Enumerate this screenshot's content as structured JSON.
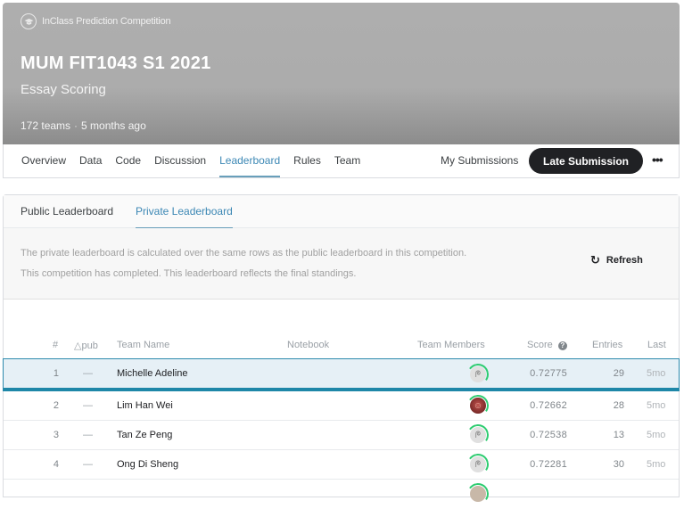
{
  "header": {
    "competition_type": "InClass Prediction Competition",
    "competition_type_icon": "graduation-cap-icon",
    "title": "MUM FIT1043 S1 2021",
    "subtitle": "Essay Scoring",
    "teams": "172 teams",
    "separator": "·",
    "time": "5 months ago"
  },
  "nav": {
    "tabs": [
      {
        "label": "Overview"
      },
      {
        "label": "Data"
      },
      {
        "label": "Code"
      },
      {
        "label": "Discussion"
      },
      {
        "label": "Leaderboard",
        "active": true
      },
      {
        "label": "Rules"
      },
      {
        "label": "Team"
      }
    ],
    "my_submissions": "My Submissions",
    "late_submission": "Late Submission",
    "more": "•••"
  },
  "leaderboard": {
    "tabs": [
      {
        "label": "Public Leaderboard"
      },
      {
        "label": "Private Leaderboard",
        "active": true
      }
    ],
    "info_line_1": "The private leaderboard is calculated over the same rows as the public leaderboard in this competition.",
    "info_line_2": "This competition has completed. This leaderboard reflects the final standings.",
    "refresh_icon": "↻",
    "refresh_label": "Refresh",
    "columns": {
      "rank": "#",
      "delta": "△pub",
      "team_name": "Team Name",
      "notebook": "Notebook",
      "team_members": "Team Members",
      "score": "Score",
      "entries": "Entries",
      "last": "Last"
    },
    "score_help_icon": "?",
    "rows": [
      {
        "rank": "1",
        "delta": "—",
        "team_name": "Michelle Adeline",
        "avatar_glyph": "ᖘ",
        "score": "0.72775",
        "entries": "29",
        "last": "5mo"
      },
      {
        "rank": "2",
        "delta": "—",
        "team_name": "Lim Han Wei",
        "avatar_glyph": "☺",
        "score": "0.72662",
        "entries": "28",
        "last": "5mo"
      },
      {
        "rank": "3",
        "delta": "—",
        "team_name": "Tan Ze Peng",
        "avatar_glyph": "ᖘ",
        "score": "0.72538",
        "entries": "13",
        "last": "5mo"
      },
      {
        "rank": "4",
        "delta": "—",
        "team_name": "Ong Di Sheng",
        "avatar_glyph": "ᖘ",
        "score": "0.72281",
        "entries": "30",
        "last": "5mo"
      }
    ]
  }
}
